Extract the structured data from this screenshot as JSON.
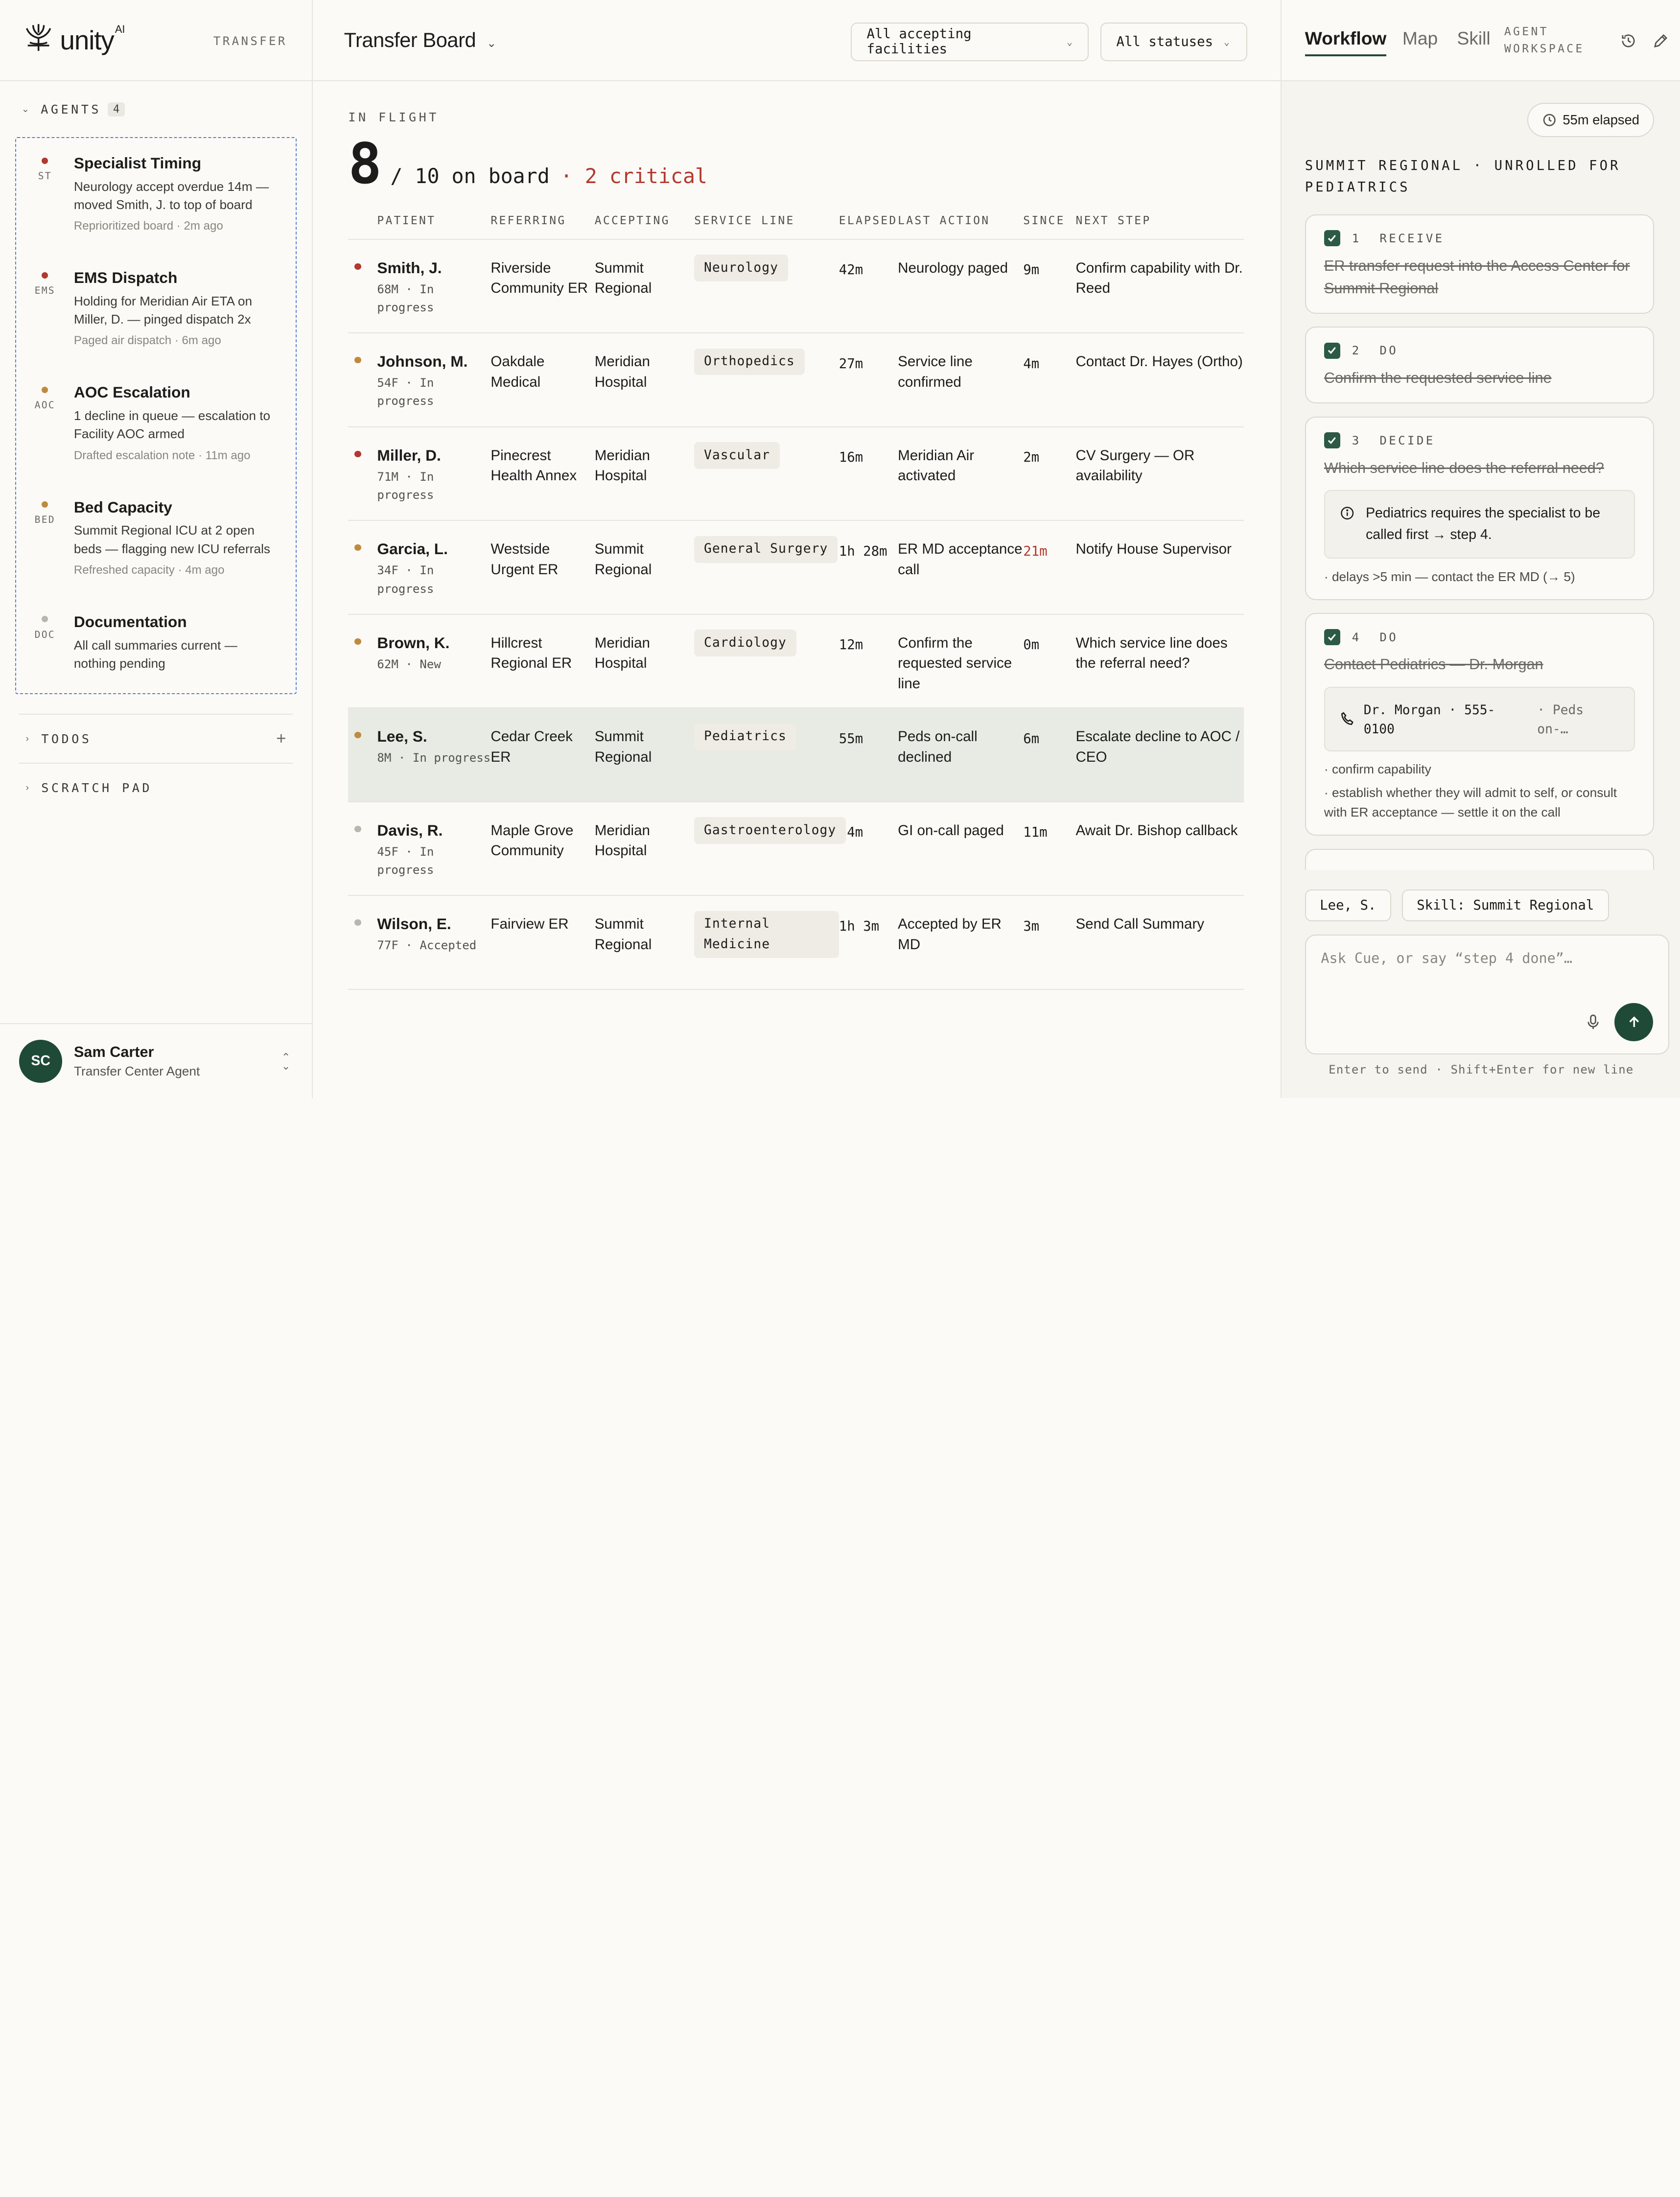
{
  "brand": {
    "name": "unity",
    "ai": "AI",
    "section": "TRANSFER"
  },
  "agents": {
    "heading": "AGENTS",
    "count": "4",
    "items": [
      {
        "code": "ST",
        "dot_color": "#b2392e",
        "title": "Specialist Timing",
        "desc": "Neurology accept overdue 14m — moved Smith, J. to top of board",
        "meta": "Reprioritized board · 2m ago"
      },
      {
        "code": "EMS",
        "dot_color": "#b2392e",
        "title": "EMS Dispatch",
        "desc": "Holding for Meridian Air ETA on Miller, D. — pinged dispatch 2x",
        "meta": "Paged air dispatch · 6m ago"
      },
      {
        "code": "AOC",
        "dot_color": "#c08a3e",
        "title": "AOC Escalation",
        "desc": "1 decline in queue — escalation to Facility AOC armed",
        "meta": "Drafted escalation note · 11m ago"
      },
      {
        "code": "BED",
        "dot_color": "#c08a3e",
        "title": "Bed Capacity",
        "desc": "Summit Regional ICU at 2 open beds — flagging new ICU referrals",
        "meta": "Refreshed capacity · 4m ago"
      },
      {
        "code": "DOC",
        "dot_color": "#b9b6ae",
        "title": "Documentation",
        "desc": "All call summaries current — nothing pending",
        "meta": ""
      }
    ]
  },
  "todos_label": "TODOS",
  "scratch_label": "SCRATCH PAD",
  "user": {
    "initials": "SC",
    "name": "Sam Carter",
    "role": "Transfer Center Agent"
  },
  "board": {
    "title": "Transfer Board",
    "filter_facilities": "All accepting facilities",
    "filter_statuses": "All statuses",
    "inflight_label": "IN FLIGHT",
    "count": "8",
    "on_board": "/ 10 on board",
    "critical": "· 2 critical",
    "columns": [
      "PATIENT",
      "REFERRING",
      "ACCEPTING",
      "SERVICE LINE",
      "ELAPSED",
      "LAST ACTION",
      "SINCE",
      "NEXT STEP"
    ],
    "rows": [
      {
        "dot": "#b2392e",
        "name": "Smith, J.",
        "sub": "68M · In progress",
        "referring": "Riverside Community ER",
        "accepting": "Summit Regional",
        "service": "Neurology",
        "elapsed": "42m",
        "last": "Neurology paged",
        "since": "9m",
        "next": "Confirm capability with Dr. Reed"
      },
      {
        "dot": "#c08a3e",
        "name": "Johnson, M.",
        "sub": "54F · In progress",
        "referring": "Oakdale Medical",
        "accepting": "Meridian Hospital",
        "service": "Orthopedics",
        "elapsed": "27m",
        "last": "Service line confirmed",
        "since": "4m",
        "next": "Contact Dr. Hayes (Ortho)"
      },
      {
        "dot": "#b2392e",
        "name": "Miller, D.",
        "sub": "71M · In progress",
        "referring": "Pinecrest Health Annex",
        "accepting": "Meridian Hospital",
        "service": "Vascular",
        "elapsed": "16m",
        "last": "Meridian Air activated",
        "since": "2m",
        "next": "CV Surgery — OR availability"
      },
      {
        "dot": "#c08a3e",
        "name": "Garcia, L.",
        "sub": "34F · In progress",
        "referring": "Westside Urgent ER",
        "accepting": "Summit Regional",
        "service": "General Surgery",
        "elapsed": "1h 28m",
        "last": "ER MD acceptance call",
        "since": "21m",
        "next": "Notify House Supervisor"
      },
      {
        "dot": "#c08a3e",
        "name": "Brown, K.",
        "sub": "62M · New",
        "referring": "Hillcrest Regional ER",
        "accepting": "Meridian Hospital",
        "service": "Cardiology",
        "elapsed": "12m",
        "last": "Confirm the requested service line",
        "since": "0m",
        "next": "Which service line does the referral need?"
      },
      {
        "dot": "#c08a3e",
        "name": "Lee, S.",
        "sub": "8M · In progress",
        "referring": "Cedar Creek ER",
        "accepting": "Summit Regional",
        "service": "Pediatrics",
        "elapsed": "55m",
        "last": "Peds on-call declined",
        "since": "6m",
        "next": "Escalate decline to AOC / CEO"
      },
      {
        "dot": "#b9b6ae",
        "name": "Davis, R.",
        "sub": "45F · In progress",
        "referring": "Maple Grove Community",
        "accepting": "Meridian Hospital",
        "service": "Gastroenterology",
        "elapsed": "34m",
        "last": "GI on-call paged",
        "since": "11m",
        "next": "Await Dr. Bishop callback"
      },
      {
        "dot": "#b9b6ae",
        "name": "Wilson, E.",
        "sub": "77F · Accepted",
        "referring": "Fairview ER",
        "accepting": "Summit Regional",
        "service": "Internal Medicine",
        "elapsed": "1h 3m",
        "last": "Accepted by ER MD",
        "since": "3m",
        "next": "Send Call Summary"
      }
    ]
  },
  "workspace": {
    "tabs": [
      "Workflow",
      "Map",
      "Skill"
    ],
    "label": "AGENT WORKSPACE",
    "elapsed": "55m elapsed",
    "heading": "SUMMIT REGIONAL · UNROLLED FOR PEDIATRICS",
    "steps": [
      {
        "num": "1",
        "kind": "RECEIVE",
        "title": "ER transfer request into the Access Center for Summit Regional"
      },
      {
        "num": "2",
        "kind": "DO",
        "title": "Confirm the requested service line"
      },
      {
        "num": "3",
        "kind": "DECIDE",
        "title": "Which service line does the referral need?",
        "note": "Pediatrics requires the specialist to be called first → step 4.",
        "bullet": "· delays >5 min — contact the ER MD (→ 5)"
      },
      {
        "num": "4",
        "kind": "DO",
        "title": "Contact Pediatrics — Dr. Morgan",
        "contact_name": "Dr. Morgan · 555-0100",
        "contact_note": "· Peds on-…",
        "bullet1": "· confirm capability",
        "bullet2": "· establish whether they will admit to self, or consult with ER acceptance — settle it on the call"
      }
    ],
    "chips": [
      "Lee, S.",
      "Skill: Summit Regional"
    ],
    "input_placeholder": "Ask Cue, or say “step 4 done”…",
    "hint": "Enter to send · Shift+Enter for new line"
  }
}
